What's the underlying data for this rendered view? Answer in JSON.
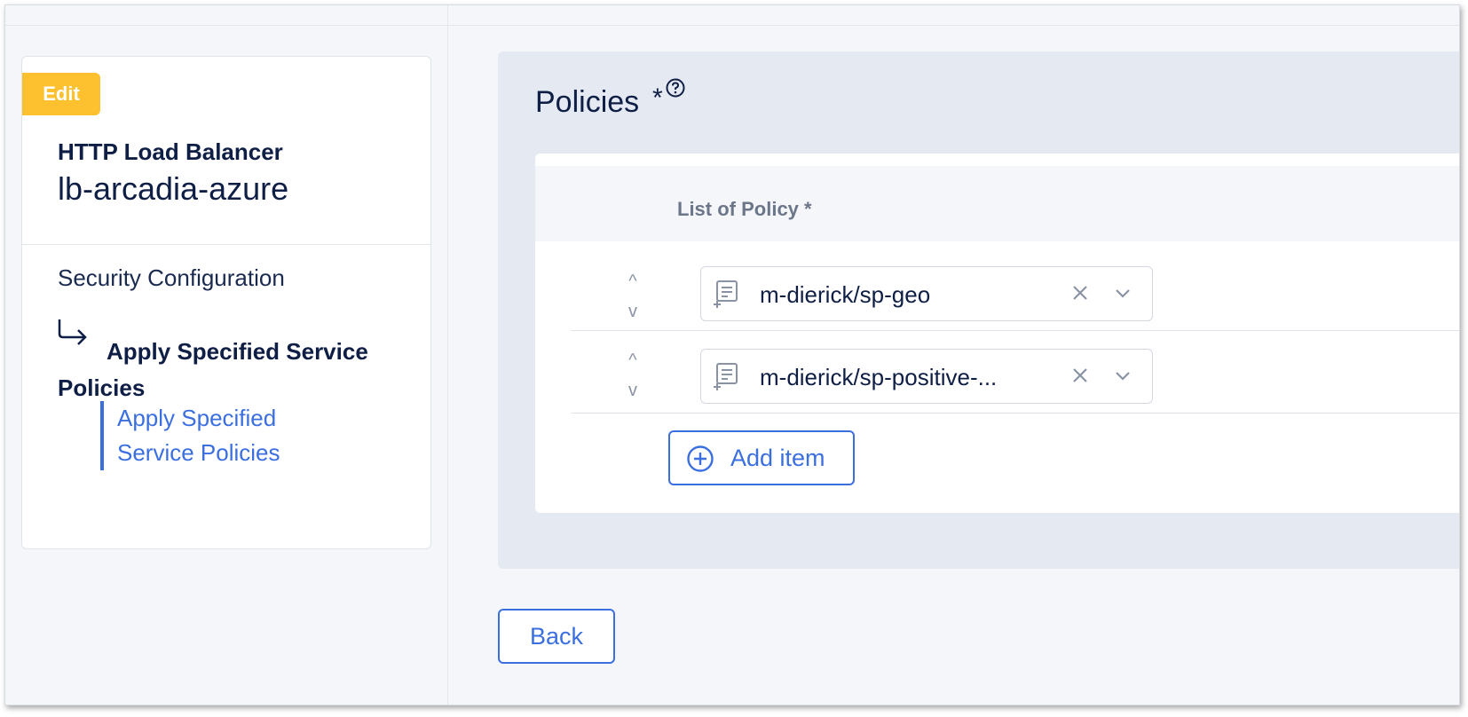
{
  "sidebar": {
    "badge": "Edit",
    "object_type": "HTTP Load Balancer",
    "object_name": "lb-arcadia-azure",
    "section": "Security Configuration",
    "step_title": "Apply Specified Service Policies",
    "sub_link": "Apply Specified Service Policies"
  },
  "panel": {
    "title": "Policies",
    "required_mark": "*",
    "column_title": "List of Policy *",
    "rows": [
      {
        "move_up": "^",
        "move_down": "v",
        "value": "m-dierick/sp-geo"
      },
      {
        "move_up": "^",
        "move_down": "v",
        "value": "m-dierick/sp-positive-..."
      }
    ],
    "add_item_label": "Add item"
  },
  "footer": {
    "back_label": "Back"
  },
  "colors": {
    "accent": "#3b6fe0",
    "badge": "#fdc02f",
    "text_dark": "#0f1e45"
  },
  "icons": [
    "arrow-return-icon",
    "help-icon",
    "policy-list-icon",
    "clear-icon",
    "chevron-down-icon",
    "plus-circle-icon"
  ]
}
